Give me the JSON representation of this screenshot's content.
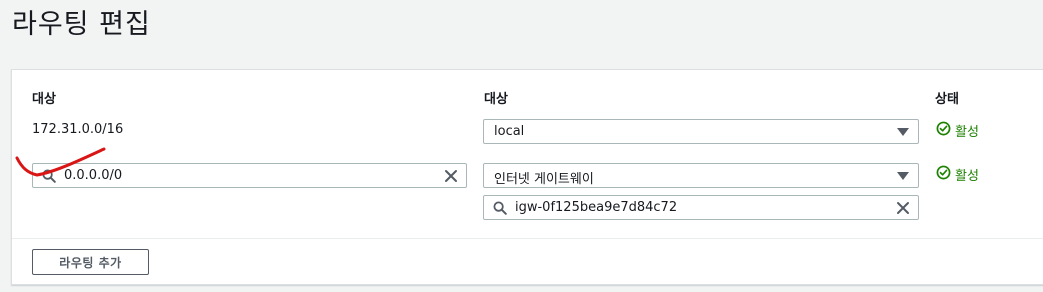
{
  "page": {
    "title": "라우팅 편집"
  },
  "table": {
    "headers": {
      "destination": "대상",
      "target": "대상",
      "status": "상태"
    },
    "rows": [
      {
        "destination": "172.31.0.0/16",
        "target_select": "local",
        "status": "활성"
      },
      {
        "destination_input": "0.0.0.0/0",
        "target_select": "인터넷 게이트웨이",
        "target_search": "igw-0f125bea9e7d84c72",
        "status": "활성"
      }
    ]
  },
  "actions": {
    "add_route": "라우팅 추가"
  },
  "colors": {
    "status_active": "#1d8102",
    "annotation_stroke": "#d91515"
  },
  "icons": {
    "search": "search-icon",
    "clear": "close-icon",
    "dropdown": "caret-down-icon",
    "status": "check-circle-icon"
  }
}
